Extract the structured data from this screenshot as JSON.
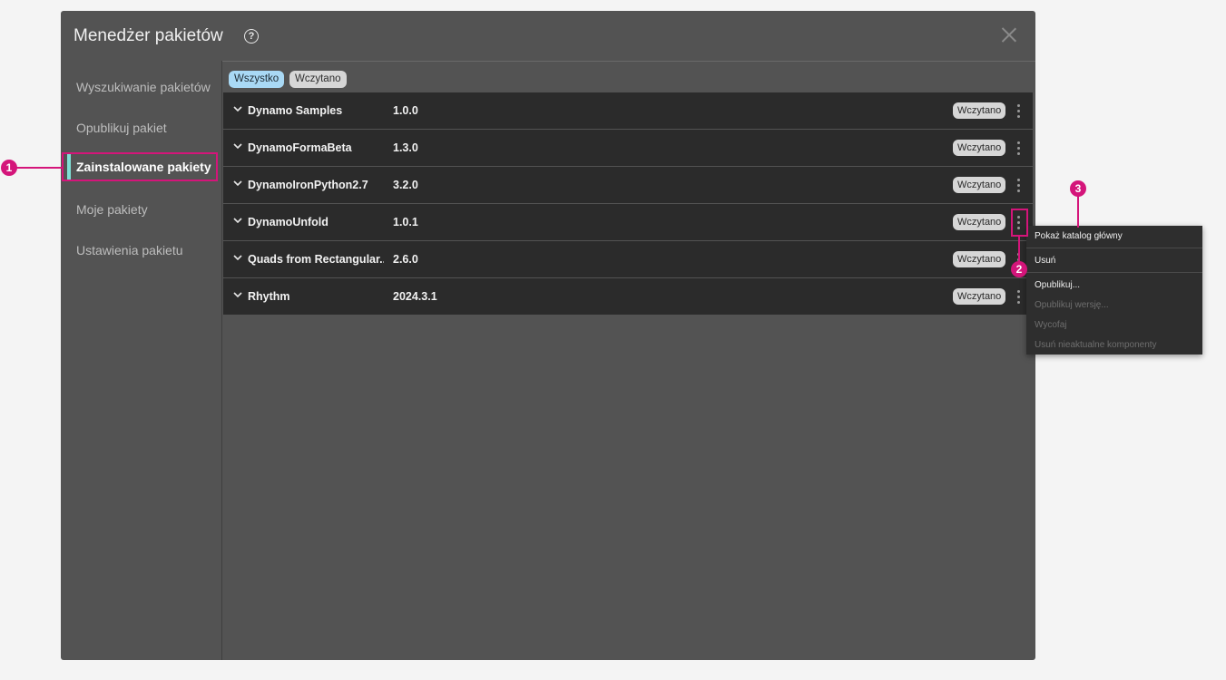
{
  "window": {
    "title": "Menedżer pakietów",
    "help_icon": "question-circle-icon",
    "close_icon": "close-icon"
  },
  "sidebar": {
    "items": [
      {
        "label": "Wyszukiwanie pakietów"
      },
      {
        "label": "Opublikuj pakiet"
      },
      {
        "label": "Zainstalowane pakiety",
        "active": true
      },
      {
        "label": "Moje pakiety"
      },
      {
        "label": "Ustawienia pakietu"
      }
    ]
  },
  "filters": {
    "all": "Wszystko",
    "loaded": "Wczytano"
  },
  "packages": [
    {
      "name": "Dynamo Samples",
      "version": "1.0.0",
      "status": "Wczytano"
    },
    {
      "name": "DynamoFormaBeta",
      "version": "1.3.0",
      "status": "Wczytano"
    },
    {
      "name": "DynamoIronPython2.7",
      "version": "3.2.0",
      "status": "Wczytano"
    },
    {
      "name": "DynamoUnfold",
      "version": "1.0.1",
      "status": "Wczytano"
    },
    {
      "name": "Quads from Rectangular...",
      "version": "2.6.0",
      "status": "Wczytano"
    },
    {
      "name": "Rhythm",
      "version": "2024.3.1",
      "status": "Wczytano"
    }
  ],
  "context_menu": {
    "items": [
      {
        "label": "Pokaż katalog główny",
        "enabled": true
      },
      {
        "label": "Usuń",
        "enabled": true
      },
      {
        "label": "Opublikuj...",
        "enabled": true
      },
      {
        "label": "Opublikuj wersję...",
        "enabled": false
      },
      {
        "label": "Wycofaj",
        "enabled": false
      },
      {
        "label": "Usuń nieaktualne komponenty",
        "enabled": false
      }
    ]
  },
  "callouts": [
    "1",
    "2",
    "3"
  ],
  "colors": {
    "accent": "#7fe0d6",
    "callout": "#d4157a",
    "chip_all": "#a9d9f5"
  }
}
